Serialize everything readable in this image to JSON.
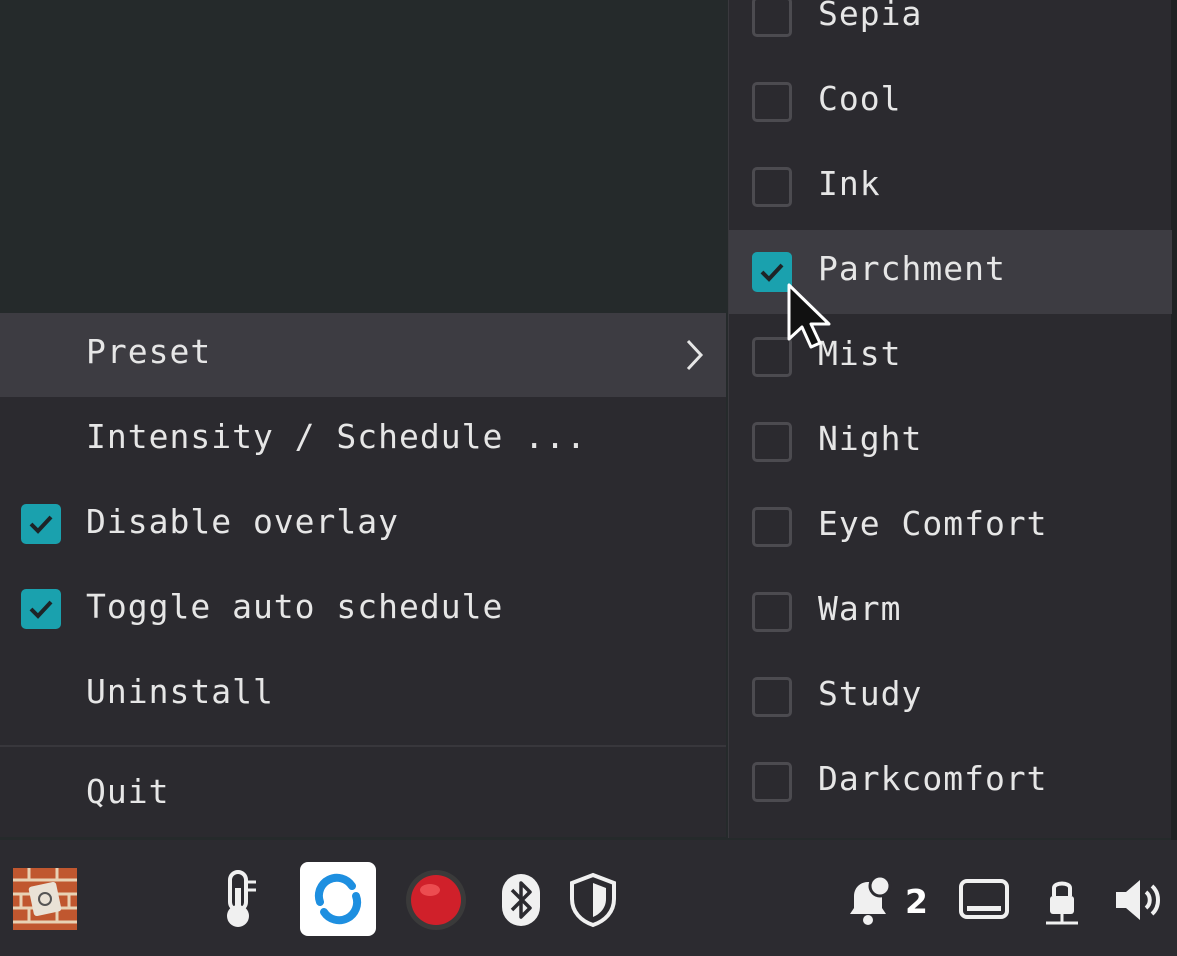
{
  "menu": {
    "items": [
      {
        "label": "Preset",
        "has_submenu": true
      },
      {
        "label": "Intensity / Schedule ..."
      },
      {
        "label": "Disable overlay",
        "checked": true
      },
      {
        "label": "Toggle auto schedule",
        "checked": true
      },
      {
        "label": "Uninstall"
      },
      {
        "label": "Quit"
      }
    ]
  },
  "preset_submenu": {
    "items": [
      {
        "label": "Sepia",
        "checked": false
      },
      {
        "label": "Cool",
        "checked": false
      },
      {
        "label": "Ink",
        "checked": false
      },
      {
        "label": "Parchment",
        "checked": true
      },
      {
        "label": "Mist",
        "checked": false
      },
      {
        "label": "Night",
        "checked": false
      },
      {
        "label": "Eye Comfort",
        "checked": false
      },
      {
        "label": "Warm",
        "checked": false
      },
      {
        "label": "Study",
        "checked": false
      },
      {
        "label": "Darkcomfort",
        "checked": false
      }
    ]
  },
  "taskbar": {
    "notification_count": "2",
    "icons": [
      "app-tray-icon",
      "thermometer-icon",
      "sync-icon",
      "record-icon",
      "bluetooth-icon",
      "shield-icon",
      "notification-bell-icon",
      "display-icon",
      "network-icon",
      "volume-icon"
    ]
  },
  "colors": {
    "accent": "#1aa1ae",
    "menu_bg": "#2b2a2f",
    "hover_bg": "#3d3c42",
    "desktop_bg": "#252a2b",
    "text": "#e6e6e6"
  }
}
